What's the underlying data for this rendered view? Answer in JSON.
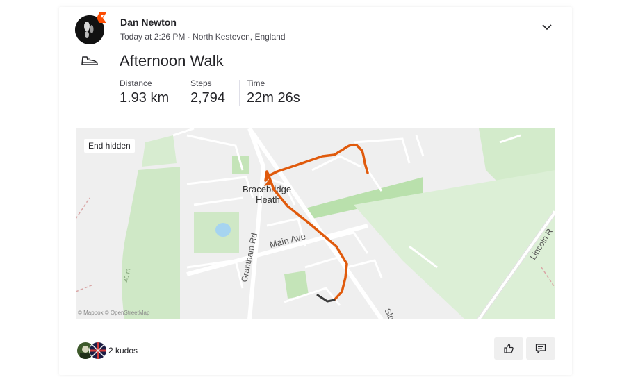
{
  "athlete": {
    "name": "Dan Newton"
  },
  "activity": {
    "timestamp": "Today at 2:26 PM",
    "location": "North Kesteven, England",
    "title": "Afternoon Walk",
    "type_icon": "walking-shoe-icon"
  },
  "stats": [
    {
      "label": "Distance",
      "value": "1.93 km"
    },
    {
      "label": "Steps",
      "value": "2,794"
    },
    {
      "label": "Time",
      "value": "22m 26s"
    }
  ],
  "map": {
    "privacy_label": "End hidden",
    "attribution": "© Mapbox © OpenStreetMap",
    "labels": {
      "town_line1": "Bracebridge",
      "town_line2": "Heath",
      "road_main": "Main Ave",
      "road_grantham": "Grantham Rd",
      "road_lincoln": "Lincoln R",
      "road_sle": "Sle",
      "contour": "40 m"
    },
    "route_color": "#E05A0C",
    "hidden_segment_color": "#3a3a3a"
  },
  "footer": {
    "kudos_text": "2 kudos",
    "kudos_icon": "thumbs-up-icon",
    "comment_icon": "comment-icon"
  },
  "colors": {
    "brand": "#FC4C02",
    "park_green": "#c9e8c0",
    "water": "#a6d4f0"
  }
}
